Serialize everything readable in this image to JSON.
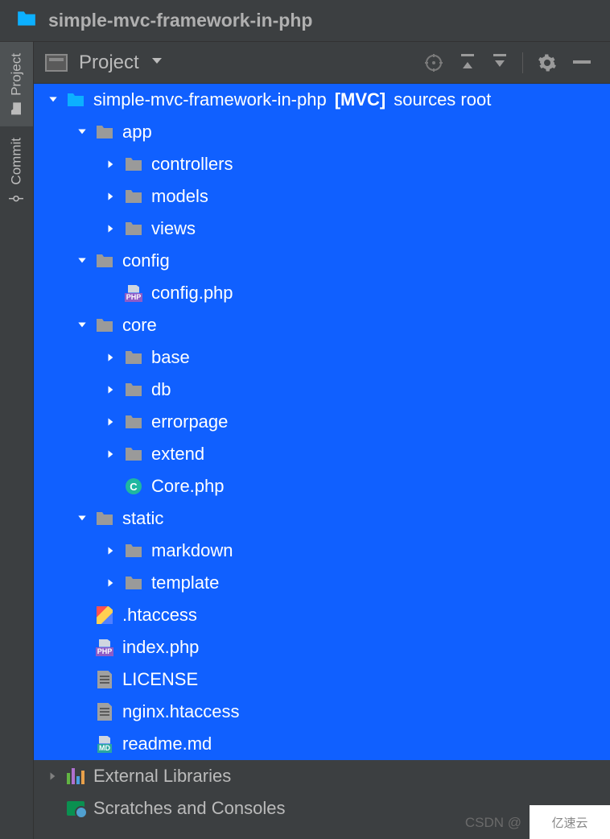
{
  "titlebar": {
    "title": "simple-mvc-framework-in-php"
  },
  "sidebar": {
    "tabs": [
      {
        "label": "Project",
        "icon": "folder"
      },
      {
        "label": "Commit",
        "icon": "commit"
      }
    ]
  },
  "panel": {
    "title": "Project"
  },
  "tree": {
    "root": {
      "name": "simple-mvc-framework-in-php",
      "tag": "[MVC]",
      "suffix": "sources root",
      "expanded": true,
      "children": [
        {
          "name": "app",
          "type": "folder",
          "expanded": true,
          "children": [
            {
              "name": "controllers",
              "type": "folder",
              "expanded": false
            },
            {
              "name": "models",
              "type": "folder",
              "expanded": false
            },
            {
              "name": "views",
              "type": "folder",
              "expanded": false
            }
          ]
        },
        {
          "name": "config",
          "type": "folder",
          "expanded": true,
          "children": [
            {
              "name": "config.php",
              "type": "php"
            }
          ]
        },
        {
          "name": "core",
          "type": "folder",
          "expanded": true,
          "children": [
            {
              "name": "base",
              "type": "folder",
              "expanded": false
            },
            {
              "name": "db",
              "type": "folder",
              "expanded": false
            },
            {
              "name": "errorpage",
              "type": "folder",
              "expanded": false
            },
            {
              "name": "extend",
              "type": "folder",
              "expanded": false
            },
            {
              "name": "Core.php",
              "type": "class"
            }
          ]
        },
        {
          "name": "static",
          "type": "folder",
          "expanded": true,
          "children": [
            {
              "name": "markdown",
              "type": "folder",
              "expanded": false
            },
            {
              "name": "template",
              "type": "folder",
              "expanded": false
            }
          ]
        },
        {
          "name": ".htaccess",
          "type": "htaccess"
        },
        {
          "name": "index.php",
          "type": "php"
        },
        {
          "name": "LICENSE",
          "type": "text"
        },
        {
          "name": "nginx.htaccess",
          "type": "text"
        },
        {
          "name": "readme.md",
          "type": "md"
        }
      ]
    },
    "external": "External Libraries",
    "scratches": "Scratches and Consoles"
  },
  "watermark": {
    "csdn": "CSDN @",
    "logo": "亿速云"
  }
}
